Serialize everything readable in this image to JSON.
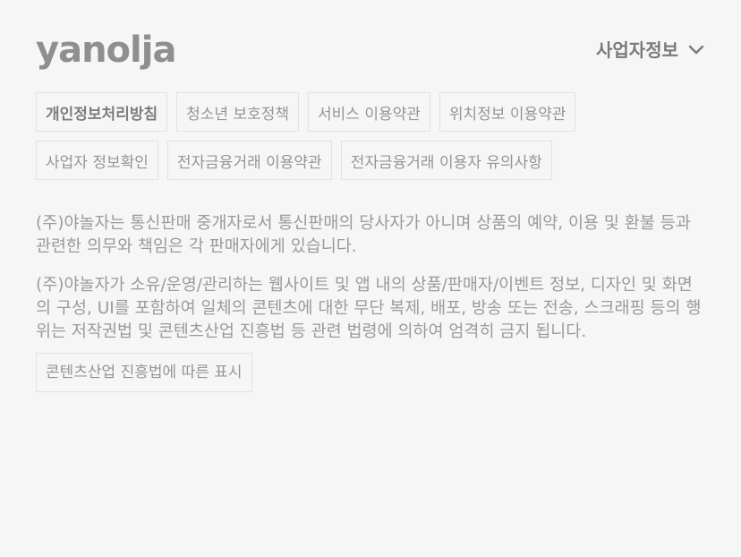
{
  "brand": {
    "logo_text": "yanolja"
  },
  "business_info": {
    "label": "사업자정보",
    "icon": "chevron-down-icon"
  },
  "footer_links": [
    {
      "label": "개인정보처리방침",
      "emphasis": true
    },
    {
      "label": "청소년 보호정책",
      "emphasis": false
    },
    {
      "label": "서비스 이용약관",
      "emphasis": false
    },
    {
      "label": "위치정보 이용약관",
      "emphasis": false
    },
    {
      "label": "사업자 정보확인",
      "emphasis": false
    },
    {
      "label": "전자금융거래 이용약관",
      "emphasis": false
    },
    {
      "label": "전자금융거래 이용자 유의사항",
      "emphasis": false
    }
  ],
  "notices": {
    "intermediary": "(주)야놀자는 통신판매 중개자로서 통신판매의 당사자가 아니며 상품의 예약, 이용 및 환불 등과 관련한 의무와 책임은 각 판매자에게 있습니다.",
    "copyright": "(주)야놀자가 소유/운영/관리하는 웹사이트 및 앱 내의 상품/판매자/이벤트 정보, 디자인 및 화면의 구성, UI를 포함하여 일체의 콘텐츠에 대한 무단 복제, 배포, 방송 또는 전송, 스크래핑 등의 행위는 저작권법 및 콘텐츠산업 진흥법 등 관련 법령에 의하여 엄격히 금지 됩니다."
  },
  "content_industry_button": {
    "label": "콘텐츠산업 진흥법에 따른 표시"
  },
  "colors": {
    "background": "#f6f6f6",
    "text": "#8a8a8a",
    "border": "#e2e2e2"
  }
}
